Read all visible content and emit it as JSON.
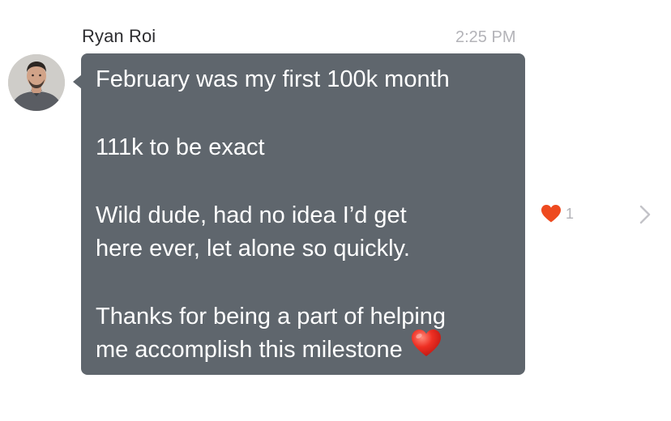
{
  "message": {
    "sender": "Ryan Roi",
    "time": "2:25 PM",
    "lines": [
      "February was my first 100k month",
      "111k to be exact",
      "Wild dude, had no idea I’d get",
      "here ever, let alone so quickly.",
      "Thanks for being a part of helping",
      "me accomplish this milestone"
    ],
    "bubble_color": "#5f666d",
    "text_color": "#ffffff",
    "emoji": "red-heart"
  },
  "reaction": {
    "icon": "heart-icon",
    "color": "#ee4a1f",
    "count": "1"
  },
  "avatar": {
    "icon": "profile-photo"
  },
  "navigation": {
    "icon": "chevron-right-icon"
  }
}
